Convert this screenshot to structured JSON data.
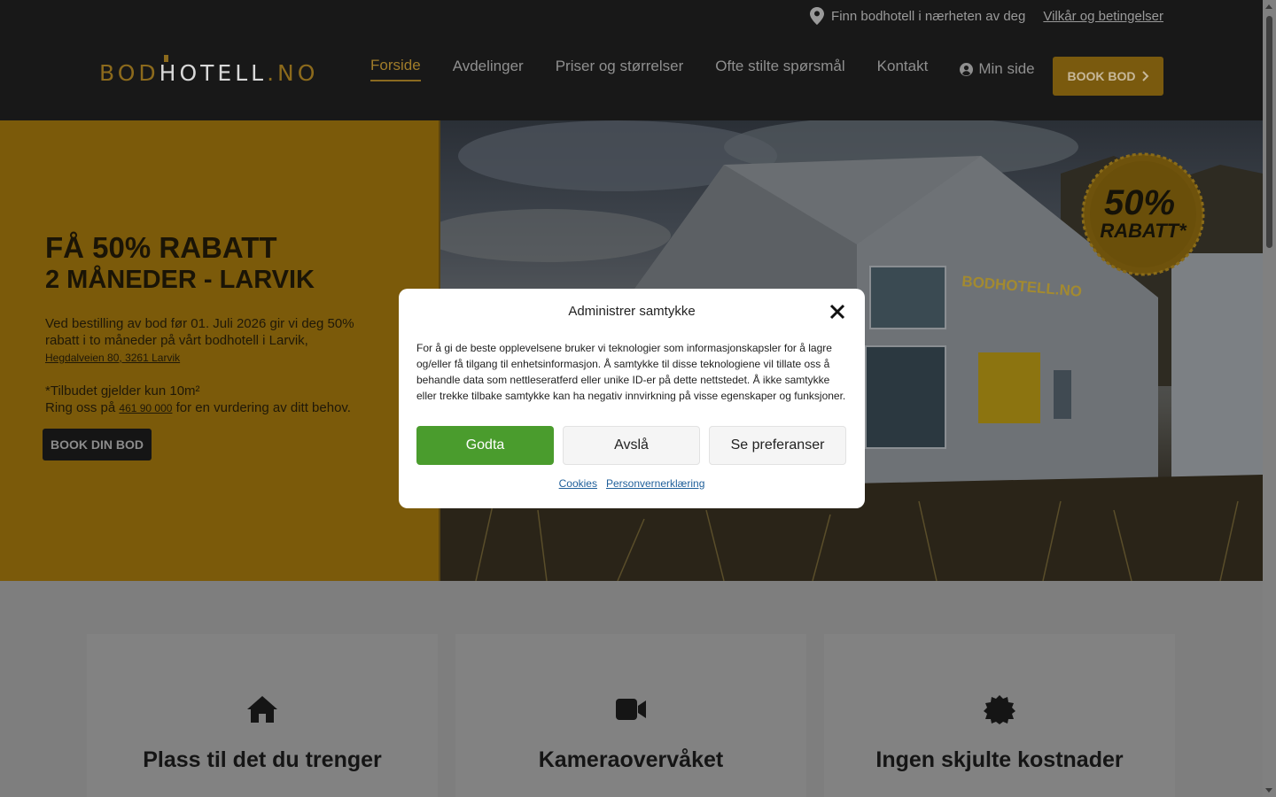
{
  "topbar": {
    "location_text": "Finn bodhotell i nærheten av deg",
    "terms_link": "Vilkår og betingelser"
  },
  "logo": {
    "part1": "BOD",
    "part2": "H",
    "part3": "OTELL",
    "part4": ".NO"
  },
  "nav": {
    "items": [
      "Forside",
      "Avdelinger",
      "Priser og størrelser",
      "Ofte stilte spørsmål",
      "Kontakt"
    ],
    "min_side": "Min side",
    "book_button": "BOOK BOD"
  },
  "hero": {
    "title_line1": "FÅ 50% RABATT",
    "title_line2": "2 MÅNEDER - LARVIK",
    "text1": "Ved bestilling av bod før 01. Juli 2026 gir vi deg 50% rabatt i to måneder på vårt bodhotell i Larvik,",
    "address": "Hegdalveien 80, 3261 Larvik",
    "text2a": "*Tilbudet gjelder kun 10m²",
    "text2b": "Ring oss på",
    "phone": "461 90 000",
    "text2c": "for en vurdering av ditt behov.",
    "button": "BOOK DIN BOD",
    "badge_pct": "50%",
    "badge_label": "RABATT*",
    "building_sign": "BODHOTELL.NO"
  },
  "features": [
    {
      "icon": "home-icon",
      "title": "Plass til det du trenger"
    },
    {
      "icon": "video-camera-icon",
      "title": "Kameraovervåket"
    },
    {
      "icon": "badge-icon",
      "title": "Ingen skjulte kostnader"
    }
  ],
  "consent": {
    "title": "Administrer samtykke",
    "body": "For å gi de beste opplevelsene bruker vi teknologier som informasjonskapsler for å lagre og/eller få tilgang til enhetsinformasjon. Å samtykke til disse teknologiene vil tillate oss å behandle data som nettleseratferd eller unike ID-er på dette nettstedet. Å ikke samtykke eller trekke tilbake samtykke kan ha negativ innvirkning på visse egenskaper og funksjoner.",
    "accept": "Godta",
    "deny": "Avslå",
    "preferences": "Se preferanser",
    "cookies_link": "Cookies",
    "privacy_link": "Personvernerklæring"
  },
  "colors": {
    "header_bg": "#181818",
    "accent": "#7b5a0a",
    "accept_green": "#4a9c2d"
  }
}
